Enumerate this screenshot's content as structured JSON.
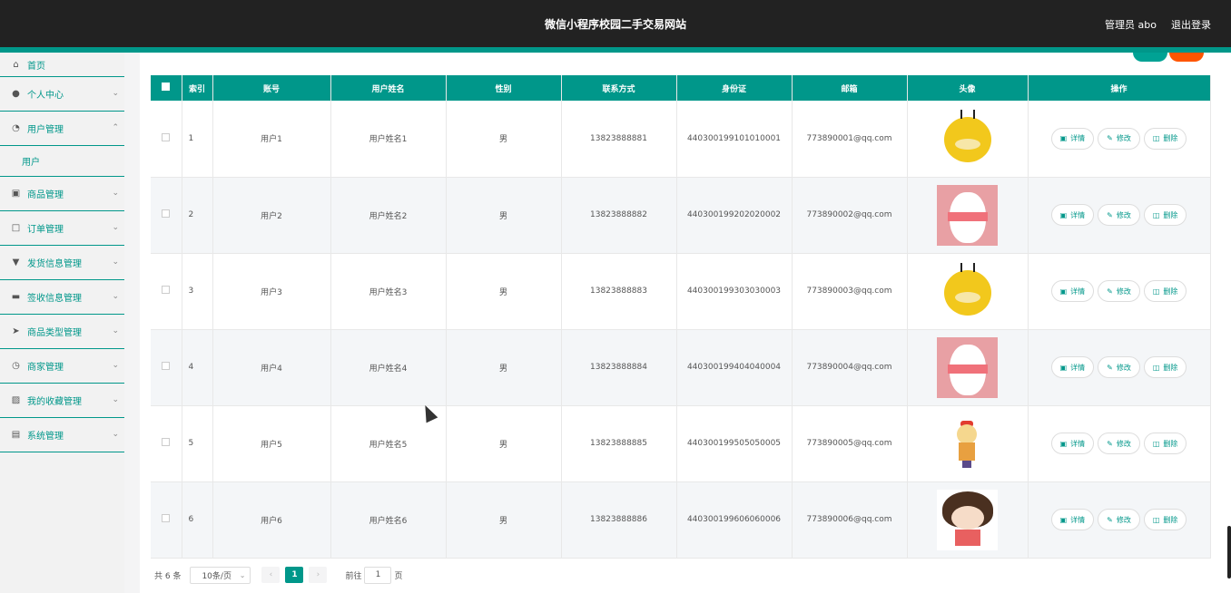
{
  "header": {
    "title": "微信小程序校园二手交易网站",
    "user": "管理员 abo",
    "logout": "退出登录"
  },
  "sidebar": {
    "items": [
      {
        "label": "首页",
        "icon": "home-icon"
      },
      {
        "label": "个人中心",
        "icon": "user-icon"
      },
      {
        "label": "用户管理",
        "icon": "gauge-icon",
        "expanded": true,
        "children": [
          {
            "label": "用户"
          }
        ]
      },
      {
        "label": "商品管理",
        "icon": "box-icon"
      },
      {
        "label": "订单管理",
        "icon": "picture-icon"
      },
      {
        "label": "发货信息管理",
        "icon": "pin-icon"
      },
      {
        "label": "签收信息管理",
        "icon": "monitor-icon"
      },
      {
        "label": "商品类型管理",
        "icon": "send-icon"
      },
      {
        "label": "商家管理",
        "icon": "clock-icon"
      },
      {
        "label": "我的收藏管理",
        "icon": "image-icon"
      },
      {
        "label": "系统管理",
        "icon": "book-icon"
      }
    ]
  },
  "table": {
    "headers": [
      "索引",
      "账号",
      "用户姓名",
      "性别",
      "联系方式",
      "身份证",
      "邮箱",
      "头像",
      "操作"
    ],
    "rows": [
      {
        "index": "1",
        "account": "用户1",
        "name": "用户姓名1",
        "gender": "男",
        "phone": "13823888881",
        "id_card": "440300199101010001",
        "email": "773890001@qq.com",
        "avatar": "duck"
      },
      {
        "index": "2",
        "account": "用户2",
        "name": "用户姓名2",
        "gender": "男",
        "phone": "13823888882",
        "id_card": "440300199202020002",
        "email": "773890002@qq.com",
        "avatar": "cat"
      },
      {
        "index": "3",
        "account": "用户3",
        "name": "用户姓名3",
        "gender": "男",
        "phone": "13823888883",
        "id_card": "440300199303030003",
        "email": "773890003@qq.com",
        "avatar": "duck"
      },
      {
        "index": "4",
        "account": "用户4",
        "name": "用户姓名4",
        "gender": "男",
        "phone": "13823888884",
        "id_card": "440300199404040004",
        "email": "773890004@qq.com",
        "avatar": "cat"
      },
      {
        "index": "5",
        "account": "用户5",
        "name": "用户姓名5",
        "gender": "男",
        "phone": "13823888885",
        "id_card": "440300199505050005",
        "email": "773890005@qq.com",
        "avatar": "girl"
      },
      {
        "index": "6",
        "account": "用户6",
        "name": "用户姓名6",
        "gender": "男",
        "phone": "13823888886",
        "id_card": "440300199606060006",
        "email": "773890006@qq.com",
        "avatar": "bob"
      }
    ],
    "actions": {
      "detail": "详情",
      "edit": "修改",
      "delete": "删除"
    }
  },
  "pagination": {
    "total": "共 6 条",
    "page_size": "10条/页",
    "current_page": "1",
    "goto_label": "前往",
    "goto_value": "1",
    "page_suffix": "页"
  },
  "colors": {
    "accent": "#00978a",
    "danger": "#ff5500",
    "topbar": "#222222"
  }
}
